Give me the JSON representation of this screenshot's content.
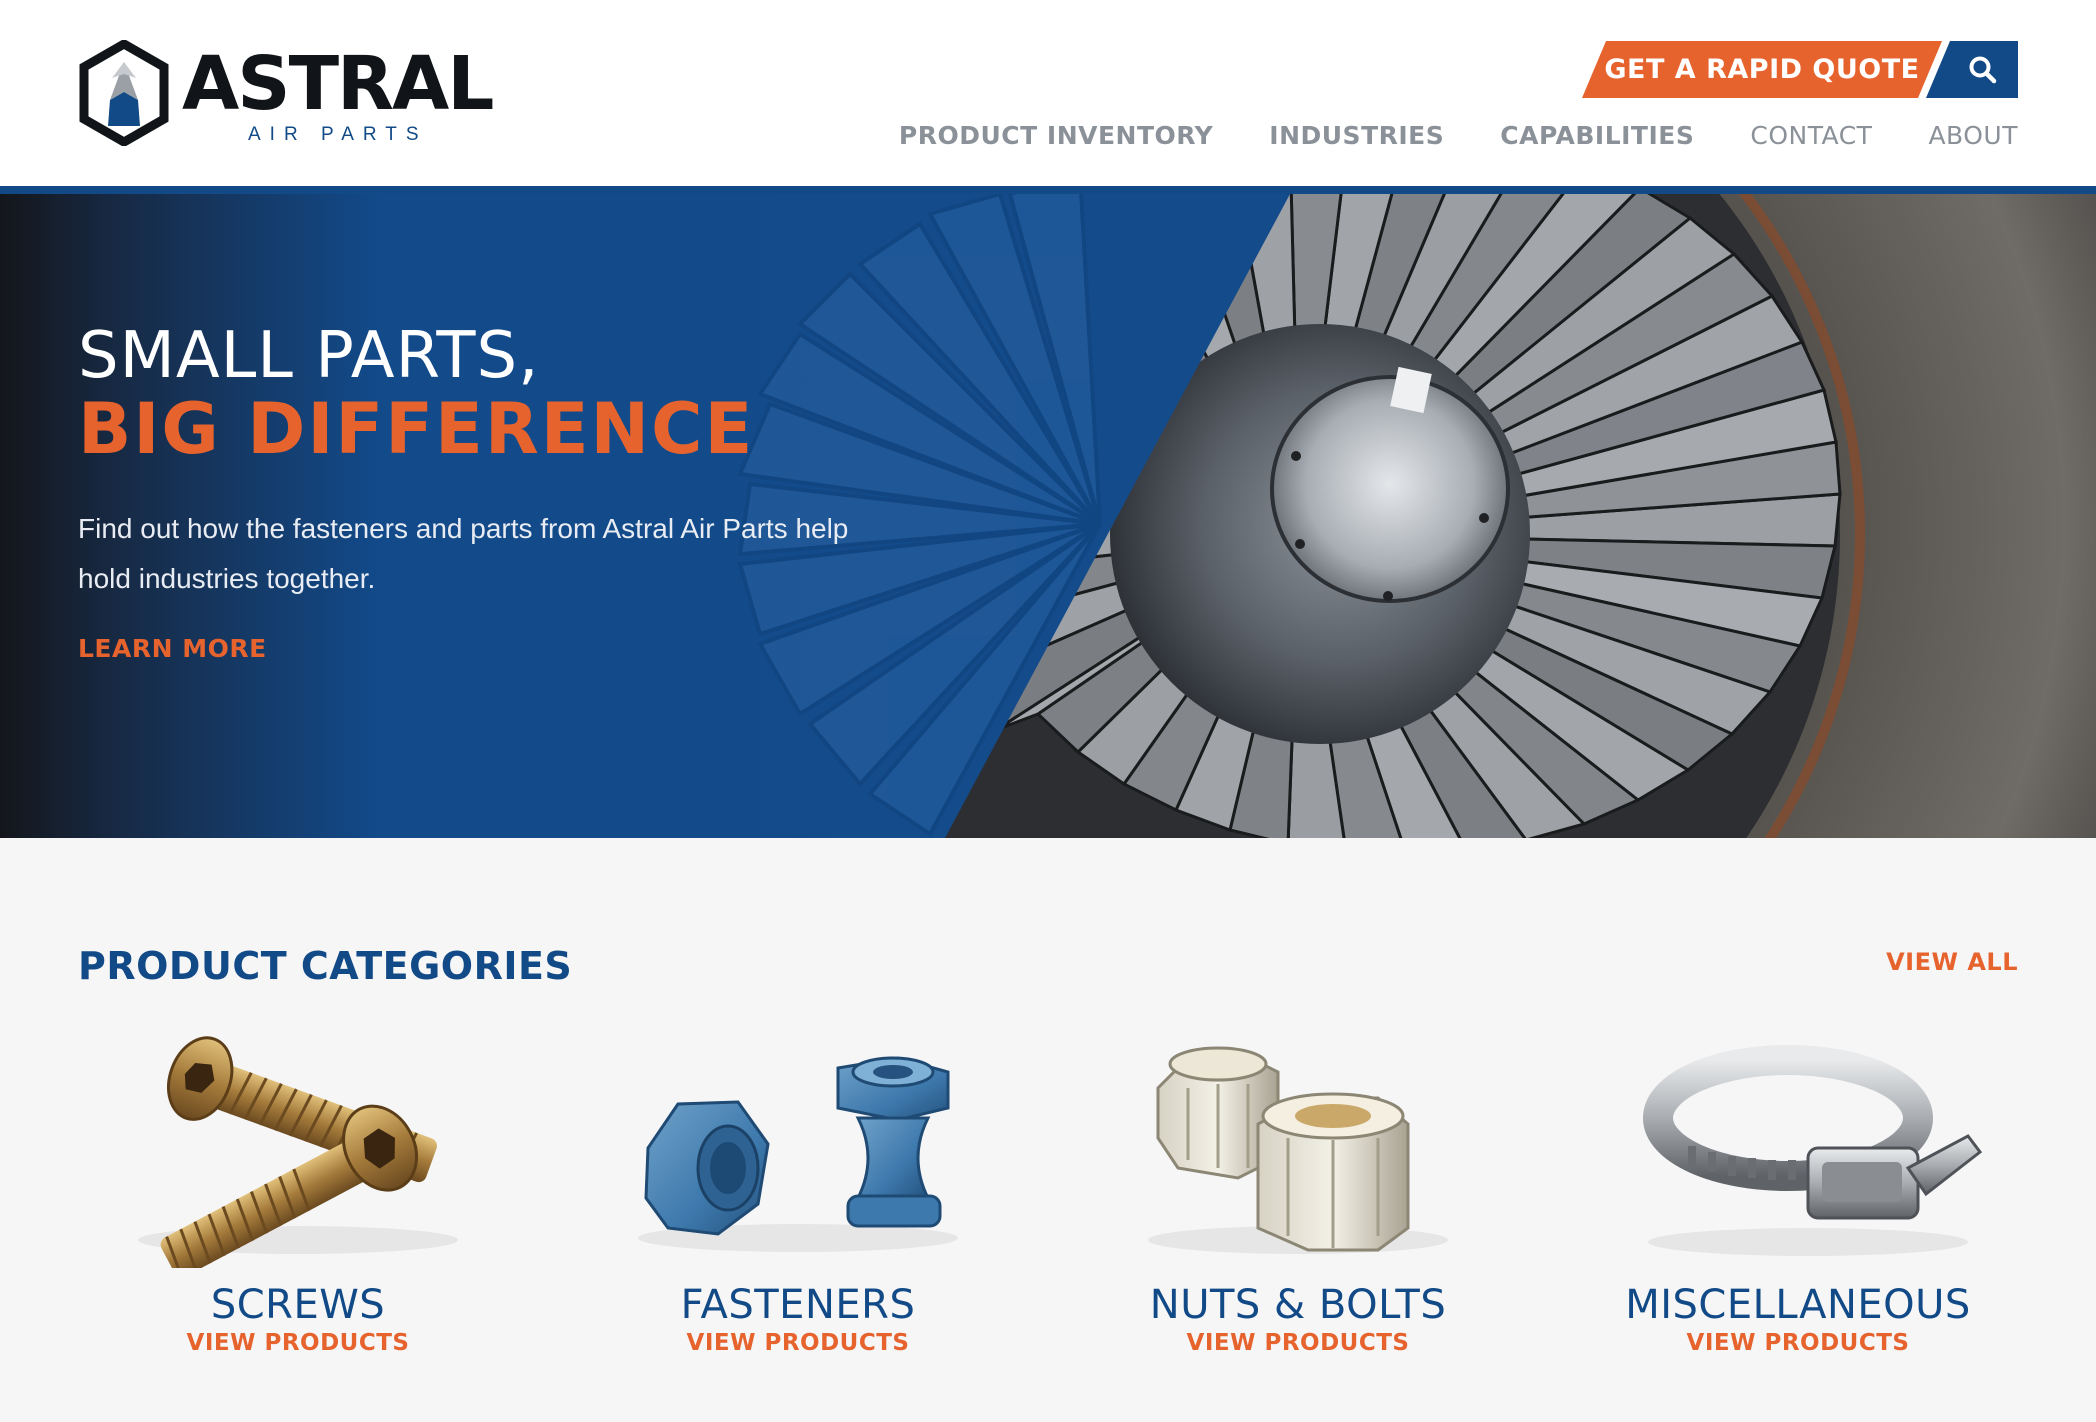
{
  "brand": {
    "name": "ASTRAL",
    "subtitle": "AIR PARTS",
    "navy": "#114a86",
    "orange": "#e7632e"
  },
  "header": {
    "quote_button": "GET A RAPID QUOTE",
    "search_icon": "search-icon",
    "nav": [
      {
        "label": "PRODUCT INVENTORY"
      },
      {
        "label": "INDUSTRIES"
      },
      {
        "label": "CAPABILITIES"
      },
      {
        "label": "CONTACT"
      },
      {
        "label": "ABOUT"
      }
    ]
  },
  "hero": {
    "title_line1": "SMALL PARTS,",
    "title_line2": "BIG DIFFERENCE",
    "description": "Find out how the fasteners and parts from Astral Air Parts help hold industries together.",
    "cta": "LEARN MORE"
  },
  "categories": {
    "title": "PRODUCT CATEGORIES",
    "view_all": "VIEW ALL",
    "items": [
      {
        "name": "SCREWS",
        "link": "VIEW PRODUCTS"
      },
      {
        "name": "FASTENERS",
        "link": "VIEW PRODUCTS"
      },
      {
        "name": "NUTS & BOLTS",
        "link": "VIEW PRODUCTS"
      },
      {
        "name": "MISCELLANEOUS",
        "link": "VIEW PRODUCTS"
      }
    ]
  }
}
